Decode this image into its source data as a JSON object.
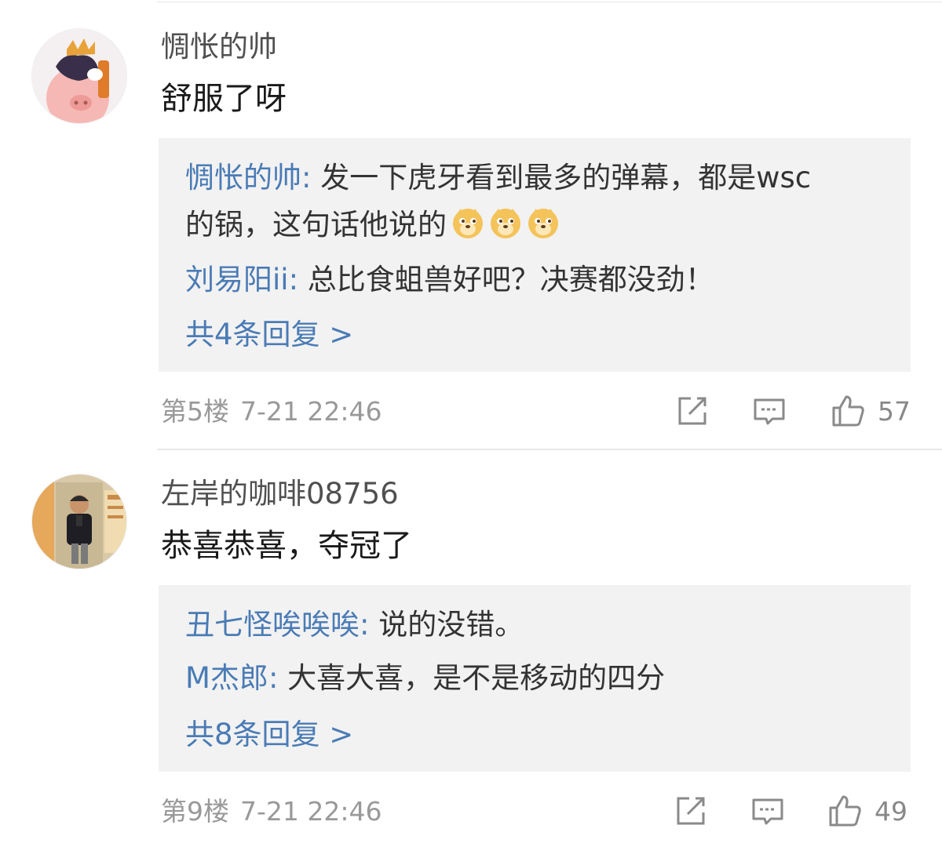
{
  "comments": [
    {
      "username": "惆怅的帅",
      "text": "舒服了呀",
      "replies": [
        {
          "user": "惆怅的帅",
          "sep": ":",
          "text_line1": " 发一下虎牙看到最多的弹幕，都是wsc",
          "text_line2": "的锅，这句话他说的"
        },
        {
          "user": "刘易阳ii",
          "sep": ":",
          "text": " 总比食蛆兽好吧？决赛都没劲！"
        }
      ],
      "more_replies": "共4条回复 >",
      "floor": "第5楼",
      "time": "7-21 22:46",
      "likes": "57",
      "emoji_name": "doge-emoji"
    },
    {
      "username": "左岸的咖啡08756",
      "text": "恭喜恭喜，夺冠了",
      "replies": [
        {
          "user": "丑七怪唉唉唉",
          "sep": ":",
          "text": " 说的没错。"
        },
        {
          "user": "M杰郎",
          "sep": ":",
          "text": " 大喜大喜，是不是移动的四分"
        }
      ],
      "more_replies": "共8条回复 >",
      "floor": "第9楼",
      "time": "7-21 22:46",
      "likes": "49"
    }
  ],
  "icons": {
    "share": "share-icon",
    "comment": "comment-icon",
    "like": "thumbs-up-icon"
  },
  "colors": {
    "link_blue": "#4a7bb5",
    "reply_bg": "#f2f2f2",
    "meta_gray": "#999999"
  }
}
